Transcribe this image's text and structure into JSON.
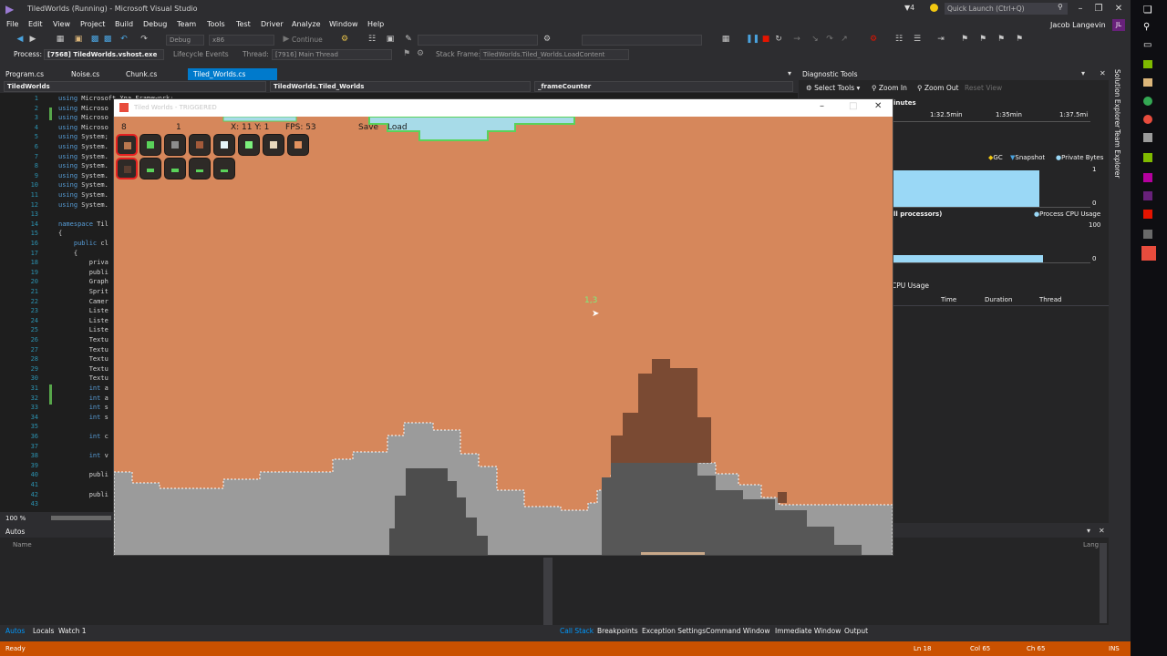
{
  "app": {
    "title": "TiledWorlds (Running) - Microsoft Visual Studio",
    "quick_launch": "Quick Launch (Ctrl+Q)",
    "user": "Jacob Langevin",
    "user_initials": "JL",
    "notifications": "4"
  },
  "menu": [
    "File",
    "Edit",
    "View",
    "Project",
    "Build",
    "Debug",
    "Team",
    "Tools",
    "Test",
    "Driver",
    "Analyze",
    "Window",
    "Help"
  ],
  "toolbar": {
    "config": "Debug",
    "platform": "x86",
    "continue_label": "Continue",
    "process_label": "Process:",
    "process_value": "[7568] TiledWorlds.vshost.exe",
    "lifecycle_label": "Lifecycle Events",
    "thread_label": "Thread:",
    "thread_value": "[7916] Main Thread",
    "stackframe_label": "Stack Frame:",
    "stackframe_value": "TiledWorlds.Tiled_Worlds.LoadContent"
  },
  "tabs": [
    "Program.cs",
    "Noise.cs",
    "Chunk.cs",
    "Tiled_Worlds.cs"
  ],
  "navbar": {
    "project": "TiledWorlds",
    "class": "TiledWorlds.Tiled_Worlds",
    "member": "_frameCounter"
  },
  "editor": {
    "lines": [
      {
        "n": "1",
        "t": "using Microsoft.Xna.Framework;"
      },
      {
        "n": "2",
        "t": "using Microso"
      },
      {
        "n": "3",
        "t": "using Microso"
      },
      {
        "n": "4",
        "t": "using Microso"
      },
      {
        "n": "5",
        "t": "using System;"
      },
      {
        "n": "6",
        "t": "using System."
      },
      {
        "n": "7",
        "t": "using System."
      },
      {
        "n": "8",
        "t": "using System."
      },
      {
        "n": "9",
        "t": "using System."
      },
      {
        "n": "10",
        "t": "using System."
      },
      {
        "n": "11",
        "t": "using System."
      },
      {
        "n": "12",
        "t": "using System."
      },
      {
        "n": "13",
        "t": ""
      },
      {
        "n": "14",
        "t": "namespace Til"
      },
      {
        "n": "15",
        "t": "{"
      },
      {
        "n": "16",
        "t": "    public cl"
      },
      {
        "n": "17",
        "t": "    {"
      },
      {
        "n": "18",
        "t": "        priva"
      },
      {
        "n": "19",
        "t": "        publi"
      },
      {
        "n": "20",
        "t": "        Graph"
      },
      {
        "n": "21",
        "t": "        Sprit"
      },
      {
        "n": "22",
        "t": "        Camer"
      },
      {
        "n": "23",
        "t": "        Liste"
      },
      {
        "n": "24",
        "t": "        Liste"
      },
      {
        "n": "25",
        "t": "        Liste"
      },
      {
        "n": "26",
        "t": "        Textu"
      },
      {
        "n": "27",
        "t": "        Textu"
      },
      {
        "n": "28",
        "t": "        Textu"
      },
      {
        "n": "29",
        "t": "        Textu"
      },
      {
        "n": "30",
        "t": "        Textu"
      },
      {
        "n": "31",
        "t": "        int a"
      },
      {
        "n": "32",
        "t": "        int a"
      },
      {
        "n": "33",
        "t": "        int s"
      },
      {
        "n": "34",
        "t": "        int s"
      },
      {
        "n": "35",
        "t": ""
      },
      {
        "n": "36",
        "t": "        int c"
      },
      {
        "n": "37",
        "t": ""
      },
      {
        "n": "38",
        "t": "        int v"
      },
      {
        "n": "39",
        "t": ""
      },
      {
        "n": "40",
        "t": "        publi"
      },
      {
        "n": "41",
        "t": ""
      },
      {
        "n": "42",
        "t": "        publi"
      },
      {
        "n": "43",
        "t": ""
      }
    ],
    "zoom": "100 %"
  },
  "diagnostic": {
    "title": "Diagnostic Tools",
    "select_tools": "Select Tools",
    "zoom_in": "Zoom In",
    "zoom_out": "Zoom Out",
    "reset_view": "Reset View",
    "minutes": "inutes",
    "ticks": [
      "1:32.5min",
      "1:35min",
      "1:37.5mi"
    ],
    "gc": "GC",
    "snapshot": "Snapshot",
    "private_bytes": "Private Bytes",
    "mem_max": "1",
    "mem_min": "0",
    "cpu_section": "ll processors)",
    "cpu_legend": "Process CPU Usage",
    "cpu_max": "100",
    "cpu_min": "0",
    "cpu_usage": "CPU Usage",
    "columns": [
      "Time",
      "Duration",
      "Thread"
    ],
    "mem_level": 0.95,
    "cpu_level": 0.18
  },
  "side_tabs": [
    "Solution Explorer",
    "Team Explorer"
  ],
  "game": {
    "window_title": "Tiled Worlds - TRIGGERED",
    "hud": {
      "count": "8",
      "one": "1",
      "coords": "X: 11 Y: 1",
      "fps": "FPS: 53",
      "save": "Save",
      "load": "Load"
    },
    "cursor_label": "1,3"
  },
  "autos": {
    "title": "Autos",
    "col_name": "Name",
    "col_lang": "Lang"
  },
  "bottom_tabs_left": [
    "Autos",
    "Locals",
    "Watch 1"
  ],
  "bottom_tabs_right": [
    "Call Stack",
    "Breakpoints",
    "Exception Settings",
    "Command Window",
    "Immediate Window",
    "Output"
  ],
  "status": {
    "ready": "Ready",
    "ln": "Ln 18",
    "col": "Col 65",
    "ch": "Ch 65",
    "ins": "INS"
  },
  "colors": {
    "accent": "#007acc",
    "status": "#ca5100",
    "sky": "#d6875b",
    "stone": "#9b9b9b"
  }
}
